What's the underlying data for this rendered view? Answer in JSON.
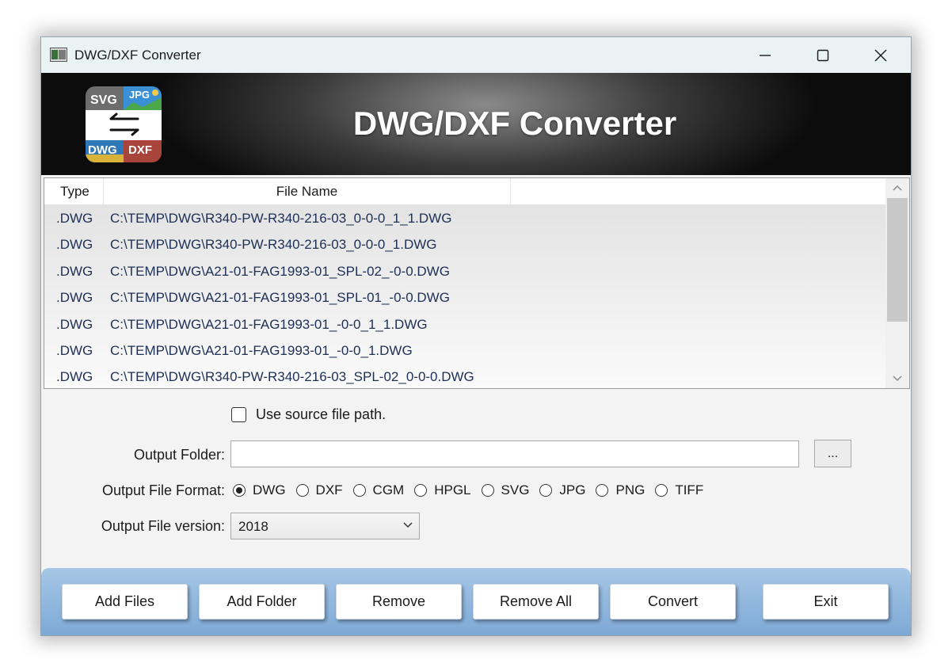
{
  "window": {
    "title": "DWG/DXF Converter"
  },
  "banner": {
    "heading": "DWG/DXF Converter",
    "logo_labels": {
      "top_left": "SVG",
      "top_right": "JPG",
      "bottom_left": "DWG",
      "bottom_right": "DXF"
    }
  },
  "file_list": {
    "columns": [
      "Type",
      "File Name"
    ],
    "rows": [
      {
        "type": ".DWG",
        "name": "C:\\TEMP\\DWG\\R340-PW-R340-216-03_0-0-0_1_1.DWG"
      },
      {
        "type": ".DWG",
        "name": "C:\\TEMP\\DWG\\R340-PW-R340-216-03_0-0-0_1.DWG"
      },
      {
        "type": ".DWG",
        "name": "C:\\TEMP\\DWG\\A21-01-FAG1993-01_SPL-02_-0-0.DWG"
      },
      {
        "type": ".DWG",
        "name": "C:\\TEMP\\DWG\\A21-01-FAG1993-01_SPL-01_-0-0.DWG"
      },
      {
        "type": ".DWG",
        "name": "C:\\TEMP\\DWG\\A21-01-FAG1993-01_-0-0_1_1.DWG"
      },
      {
        "type": ".DWG",
        "name": "C:\\TEMP\\DWG\\A21-01-FAG1993-01_-0-0_1.DWG"
      },
      {
        "type": ".DWG",
        "name": "C:\\TEMP\\DWG\\R340-PW-R340-216-03_SPL-02_0-0-0.DWG"
      }
    ]
  },
  "options": {
    "use_source_label": "Use source file path.",
    "use_source_checked": false,
    "output_folder_label": "Output Folder:",
    "output_folder_value": "",
    "browse_label": "...",
    "format_label": "Output File Format:",
    "formats": [
      "DWG",
      "DXF",
      "CGM",
      "HPGL",
      "SVG",
      "JPG",
      "PNG",
      "TIFF"
    ],
    "selected_format": "DWG",
    "version_label": "Output File version:",
    "version_value": "2018"
  },
  "buttons": {
    "add_files": "Add Files",
    "add_folder": "Add Folder",
    "remove": "Remove",
    "remove_all": "Remove All",
    "convert": "Convert",
    "exit": "Exit"
  },
  "colors": {
    "list_text": "#1e2f55",
    "button_bar": "#8fb6de",
    "title_bar": "#e9f3f4"
  }
}
